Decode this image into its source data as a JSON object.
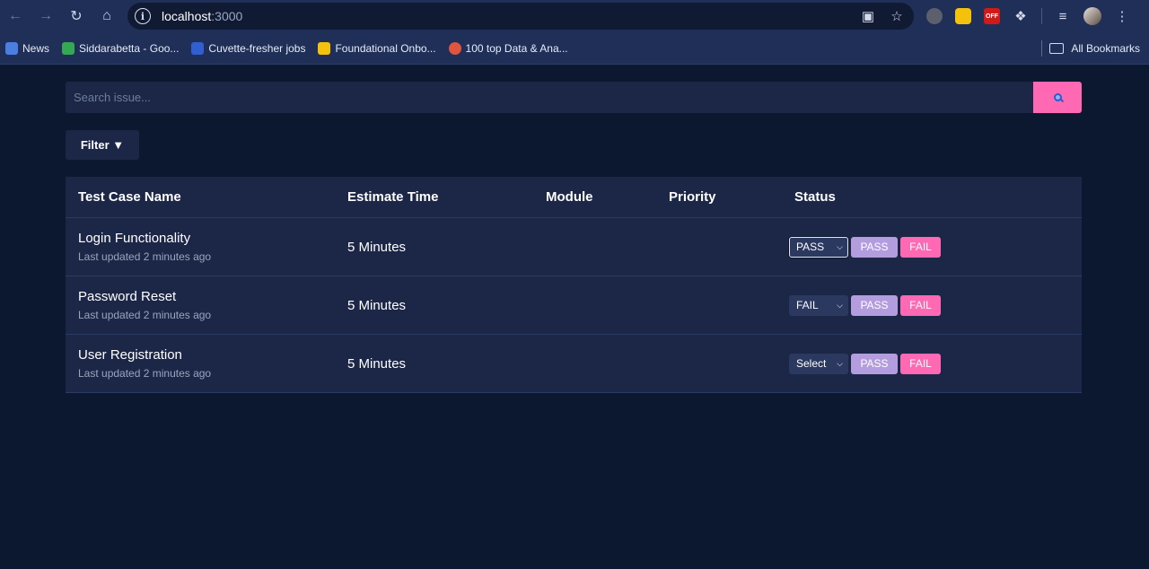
{
  "browser": {
    "url_host": "localhost",
    "url_port": ":3000",
    "bookmarks": [
      {
        "label": "News",
        "color": "#4a7fe0"
      },
      {
        "label": "Siddarabetta - Goo...",
        "color": "#34a853"
      },
      {
        "label": "Cuvette-fresher jobs",
        "color": "#2f5fd0"
      },
      {
        "label": "Foundational Onbo...",
        "color": "#f4c20d"
      },
      {
        "label": "100 top Data & Ana...",
        "color": "#e0553f"
      }
    ],
    "all_bookmarks": "All Bookmarks",
    "extension_off_badge": "OFF"
  },
  "search": {
    "placeholder": "Search issue..."
  },
  "filter": {
    "label": "Filter ▼"
  },
  "table": {
    "headers": {
      "name": "Test Case Name",
      "estimate": "Estimate Time",
      "module": "Module",
      "priority": "Priority",
      "status": "Status"
    },
    "rows": [
      {
        "name": "Login Functionality",
        "updated": "Last updated 2 minutes ago",
        "estimate": "5 Minutes",
        "module": "",
        "priority": "",
        "status": "PASS",
        "pass_label": "PASS",
        "fail_label": "FAIL"
      },
      {
        "name": "Password Reset",
        "updated": "Last updated 2 minutes ago",
        "estimate": "5 Minutes",
        "module": "",
        "priority": "",
        "status": "FAIL",
        "pass_label": "PASS",
        "fail_label": "FAIL"
      },
      {
        "name": "User Registration",
        "updated": "Last updated 2 minutes ago",
        "estimate": "5 Minutes",
        "module": "",
        "priority": "",
        "status": "Select",
        "pass_label": "PASS",
        "fail_label": "FAIL"
      }
    ]
  },
  "colors": {
    "page_bg": "#0b1830",
    "panel_bg": "#1c2748",
    "accent_pink": "#ff69b4",
    "pass_purple": "#b49ddf"
  }
}
